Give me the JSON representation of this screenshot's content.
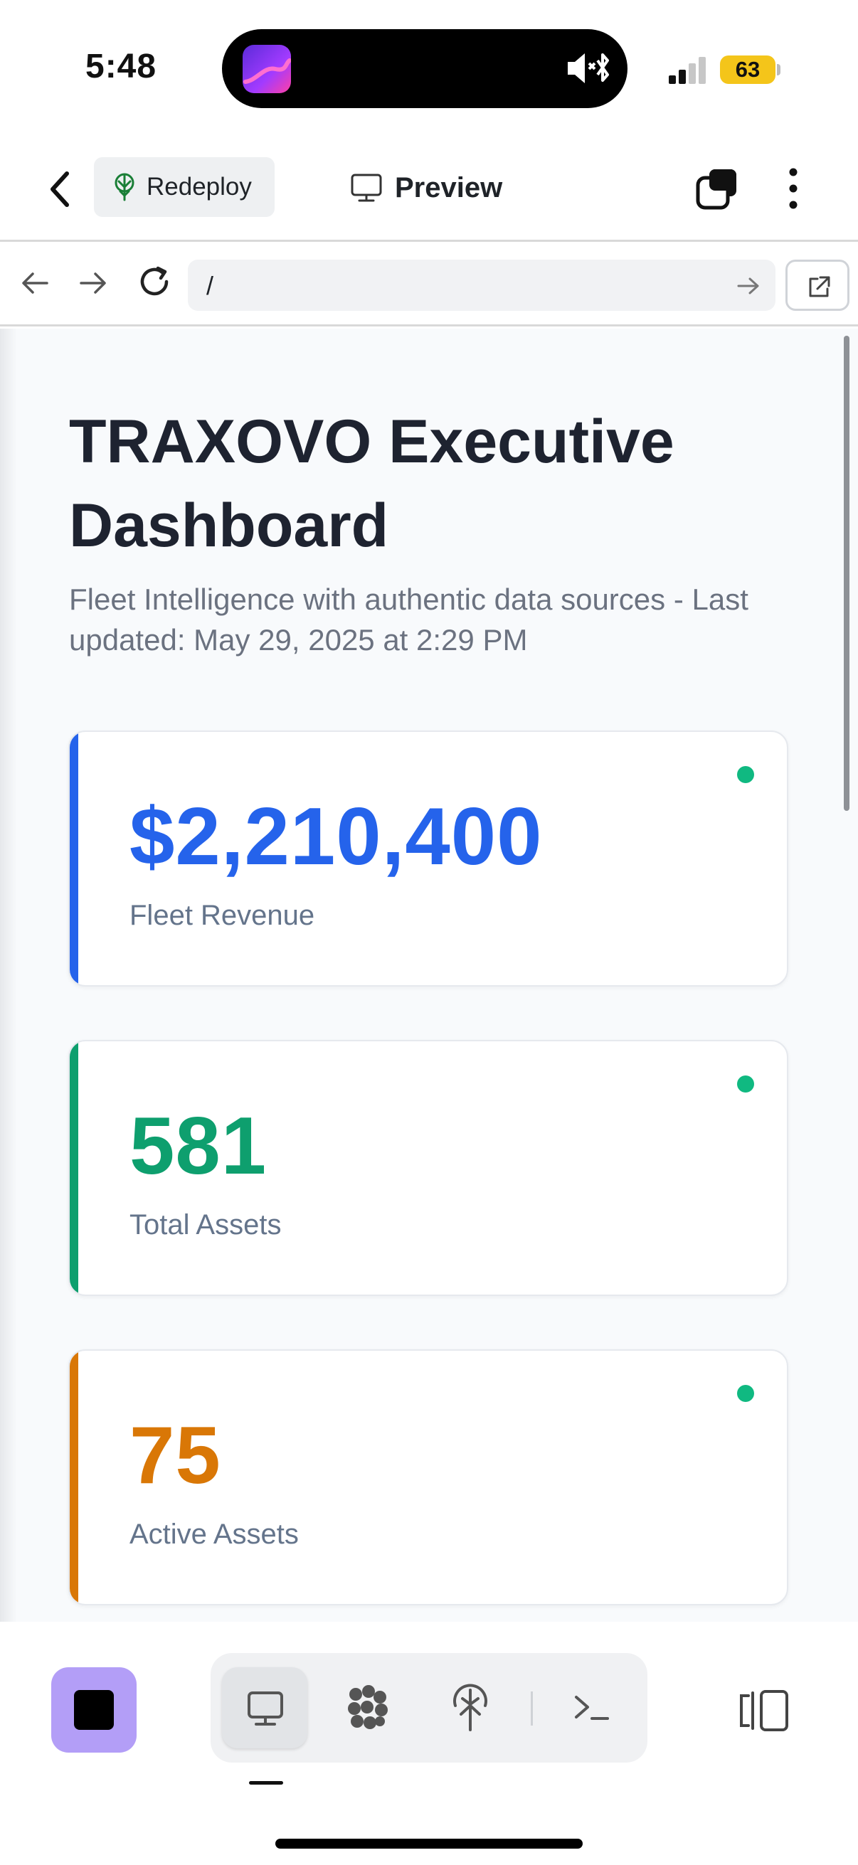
{
  "status_bar": {
    "time": "5:48",
    "battery": "63",
    "battery_color": "#f4c51a"
  },
  "toolbar": {
    "redeploy_label": "Redeploy",
    "preview_label": "Preview"
  },
  "browser": {
    "url": "/"
  },
  "dashboard": {
    "title": "TRAXOVO Executive Dashboard",
    "subtitle": "Fleet Intelligence with authentic data sources - Last updated: May 29, 2025 at 2:29 PM",
    "metrics": [
      {
        "value": "$2,210,400",
        "label": "Fleet Revenue",
        "color": "#2563eb"
      },
      {
        "value": "581",
        "label": "Total Assets",
        "color": "#0e9f6e"
      },
      {
        "value": "75",
        "label": "Active Assets",
        "color": "#d97706"
      }
    ],
    "status_dot_color": "#10b981"
  },
  "bottom_bar": {
    "stop_button_color": "#b39ef7",
    "tools": [
      "preview-icon",
      "agents-icon",
      "deploy-icon",
      "console-icon"
    ],
    "active_tool": "preview-icon"
  }
}
